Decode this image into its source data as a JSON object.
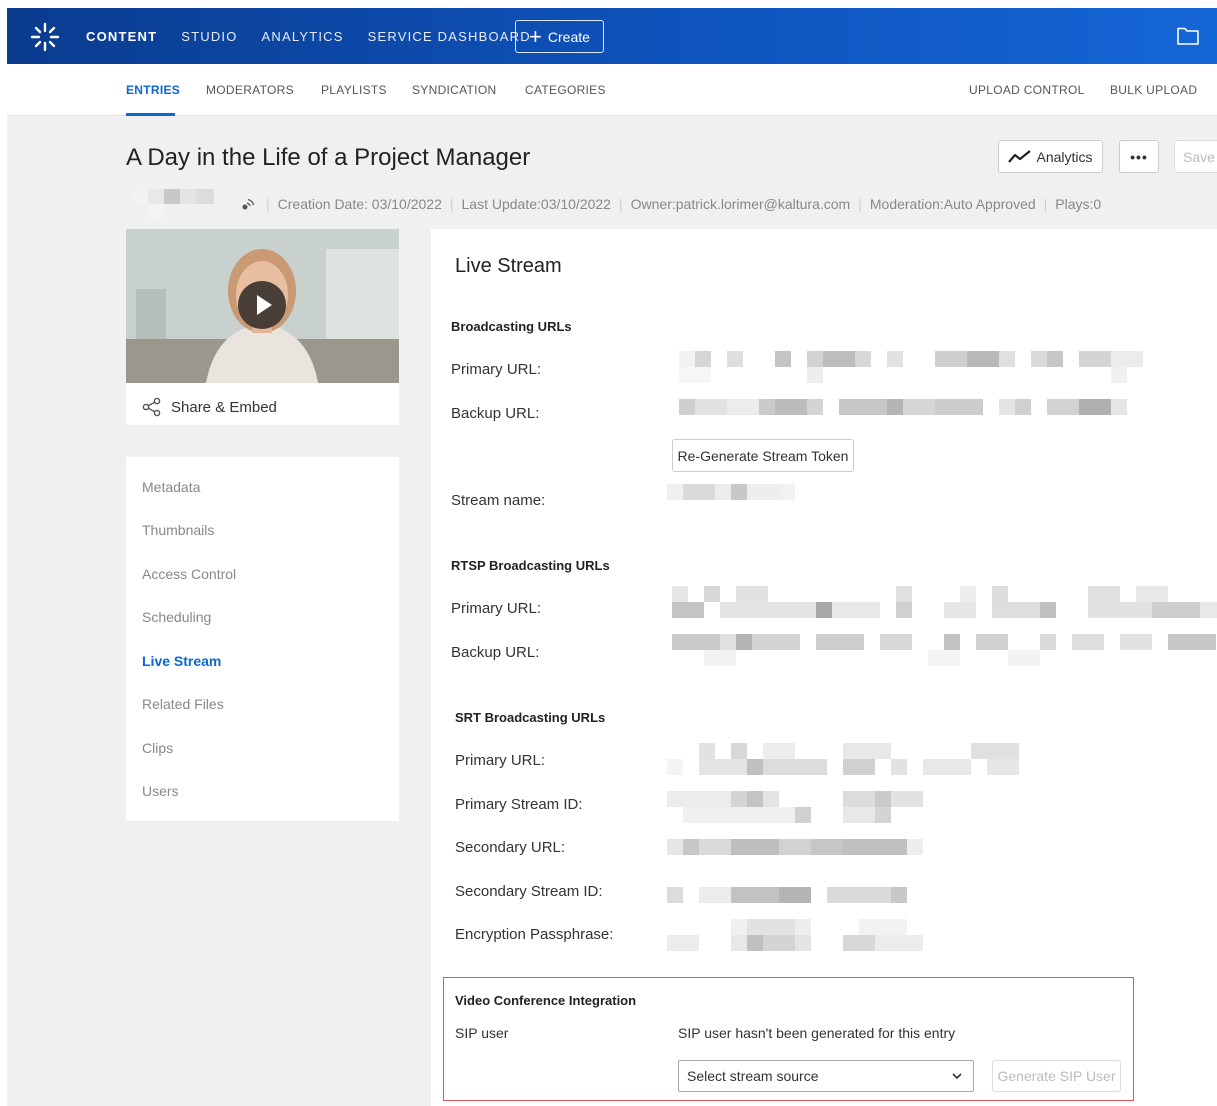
{
  "topbar": {
    "nav": [
      "CONTENT",
      "STUDIO",
      "ANALYTICS",
      "SERVICE DASHBOARD"
    ],
    "active": "CONTENT",
    "create_label": "Create",
    "logo_icon": "kaltura-logo-icon",
    "folder_icon": "folder-icon"
  },
  "subnav": {
    "left": [
      "ENTRIES",
      "MODERATORS",
      "PLAYLISTS",
      "SYNDICATION",
      "CATEGORIES"
    ],
    "right": [
      "UPLOAD CONTROL",
      "BULK UPLOAD"
    ],
    "active": "ENTRIES"
  },
  "entry": {
    "title": "A Day in the Life of a Project Manager",
    "creation_date": "Creation Date: 03/10/2022",
    "last_update": "Last Update:03/10/2022",
    "owner": "Owner:patrick.lorimer@kaltura.com",
    "moderation": "Moderation:Auto Approved",
    "plays": "Plays:0"
  },
  "actions": {
    "analytics_label": "Analytics",
    "more_label": "•••",
    "save_label": "Save"
  },
  "thumbnail": {
    "share_label": "Share & Embed"
  },
  "side_menu": {
    "items": [
      "Metadata",
      "Thumbnails",
      "Access Control",
      "Scheduling",
      "Live Stream",
      "Related Files",
      "Clips",
      "Users"
    ],
    "active": "Live Stream"
  },
  "live_stream": {
    "title": "Live Stream",
    "broadcasting": {
      "heading": "Broadcasting URLs",
      "primary_label": "Primary URL:",
      "backup_label": "Backup URL:",
      "regenerate_label": "Re-Generate Stream Token",
      "stream_name_label": "Stream name:"
    },
    "rtsp": {
      "heading": "RTSP Broadcasting URLs",
      "primary_label": "Primary URL:",
      "backup_label": "Backup URL:"
    },
    "srt": {
      "heading": "SRT Broadcasting URLs",
      "primary_url_label": "Primary URL:",
      "primary_stream_id_label": "Primary Stream ID:",
      "secondary_url_label": "Secondary URL:",
      "secondary_stream_id_label": "Secondary Stream ID:",
      "passphrase_label": "Encryption Passphrase:"
    },
    "vci": {
      "heading": "Video Conference Integration",
      "sip_user_label": "SIP user",
      "sip_status": "SIP user hasn't been generated for this entry",
      "select_placeholder": "Select stream source",
      "generate_label": "Generate SIP User"
    }
  }
}
